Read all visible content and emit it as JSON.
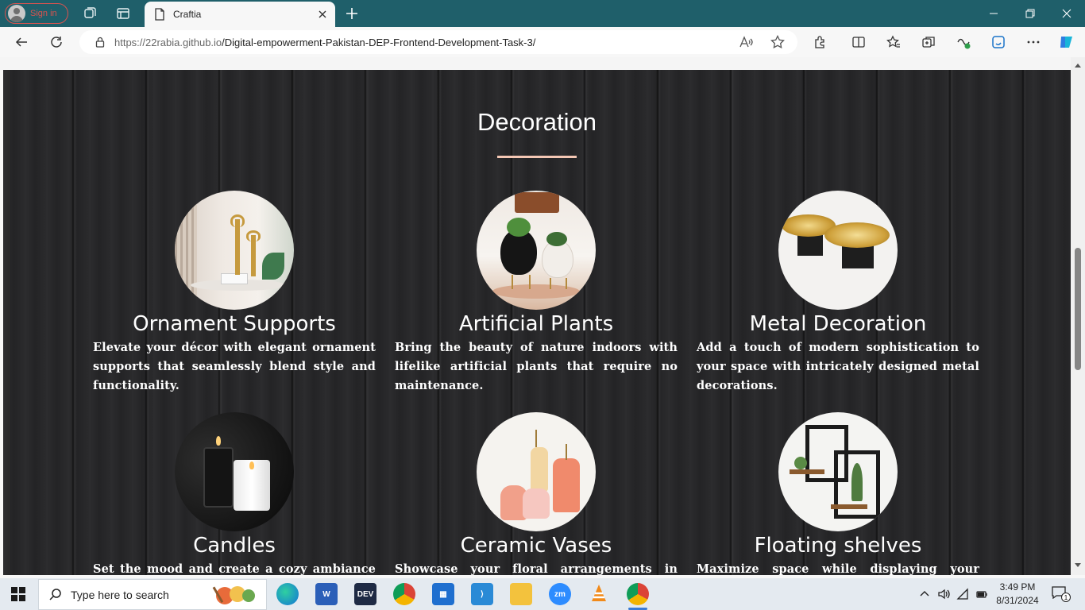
{
  "browser": {
    "profile_label": "Sign in",
    "tab_title": "Craftia",
    "url_host": "https://22rabia.github.io",
    "url_path": "/Digital-empowerment-Pakistan-DEP-Frontend-Development-Task-3/"
  },
  "page": {
    "section_title": "Decoration",
    "cards": [
      {
        "title": "Ornament Supports",
        "desc": "Elevate your décor with elegant ornament supports that seamlessly blend style and functionality."
      },
      {
        "title": "Artificial Plants",
        "desc": "Bring the beauty of nature indoors with lifelike artificial plants that require no maintenance."
      },
      {
        "title": "Metal Decoration",
        "desc": "Add a touch of modern sophistication to your space with intricately designed metal decorations."
      },
      {
        "title": "Candles",
        "desc": "Set the mood and create a cozy ambiance with"
      },
      {
        "title": "Ceramic Vases",
        "desc": "Showcase your floral arrangements in stunning"
      },
      {
        "title": "Floating shelves",
        "desc": "Maximize space while displaying your treasures"
      }
    ]
  },
  "taskbar": {
    "search_placeholder": "Type here to search",
    "dev_label": "DEV",
    "zoom_label": "zm",
    "time": "3:49 PM",
    "date": "8/31/2024",
    "notification_count": "1"
  },
  "colors": {
    "titlebar": "#1f5f6a",
    "accent_underline": "#f4c7b4",
    "page_bg": "#262628"
  }
}
